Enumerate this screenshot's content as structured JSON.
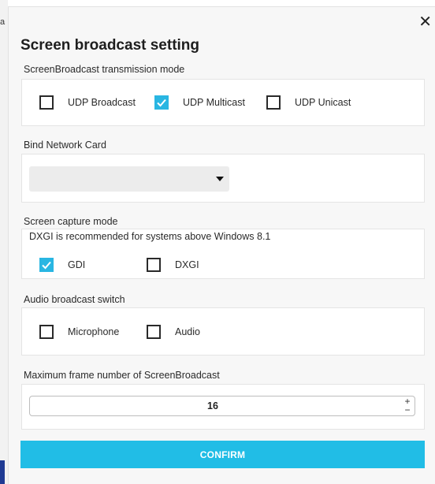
{
  "background": {
    "edge_glyph": "a",
    "accent_color": "#1f3a93"
  },
  "dialog": {
    "title": "Screen broadcast setting",
    "close_icon": "close-icon",
    "close_glyph": "✕"
  },
  "transmission": {
    "label": "ScreenBroadcast transmission mode",
    "options": [
      {
        "label": "UDP Broadcast",
        "checked": false
      },
      {
        "label": "UDP Multicast",
        "checked": true
      },
      {
        "label": "UDP Unicast",
        "checked": false
      }
    ]
  },
  "network": {
    "label": "Bind Network Card",
    "selected": ""
  },
  "capture": {
    "label": "Screen capture mode",
    "hint": "DXGI is recommended for systems above Windows 8.1",
    "options": [
      {
        "label": "GDI",
        "checked": true
      },
      {
        "label": "DXGI",
        "checked": false
      }
    ]
  },
  "audio": {
    "label": "Audio broadcast switch",
    "options": [
      {
        "label": "Microphone",
        "checked": false
      },
      {
        "label": "Audio",
        "checked": false
      }
    ]
  },
  "frames": {
    "label": "Maximum frame number of ScreenBroadcast",
    "value": "16",
    "plus": "+",
    "minus": "−"
  },
  "confirm_label": "CONFIRM",
  "colors": {
    "accent": "#29b6e2",
    "confirm": "#21bde6"
  }
}
